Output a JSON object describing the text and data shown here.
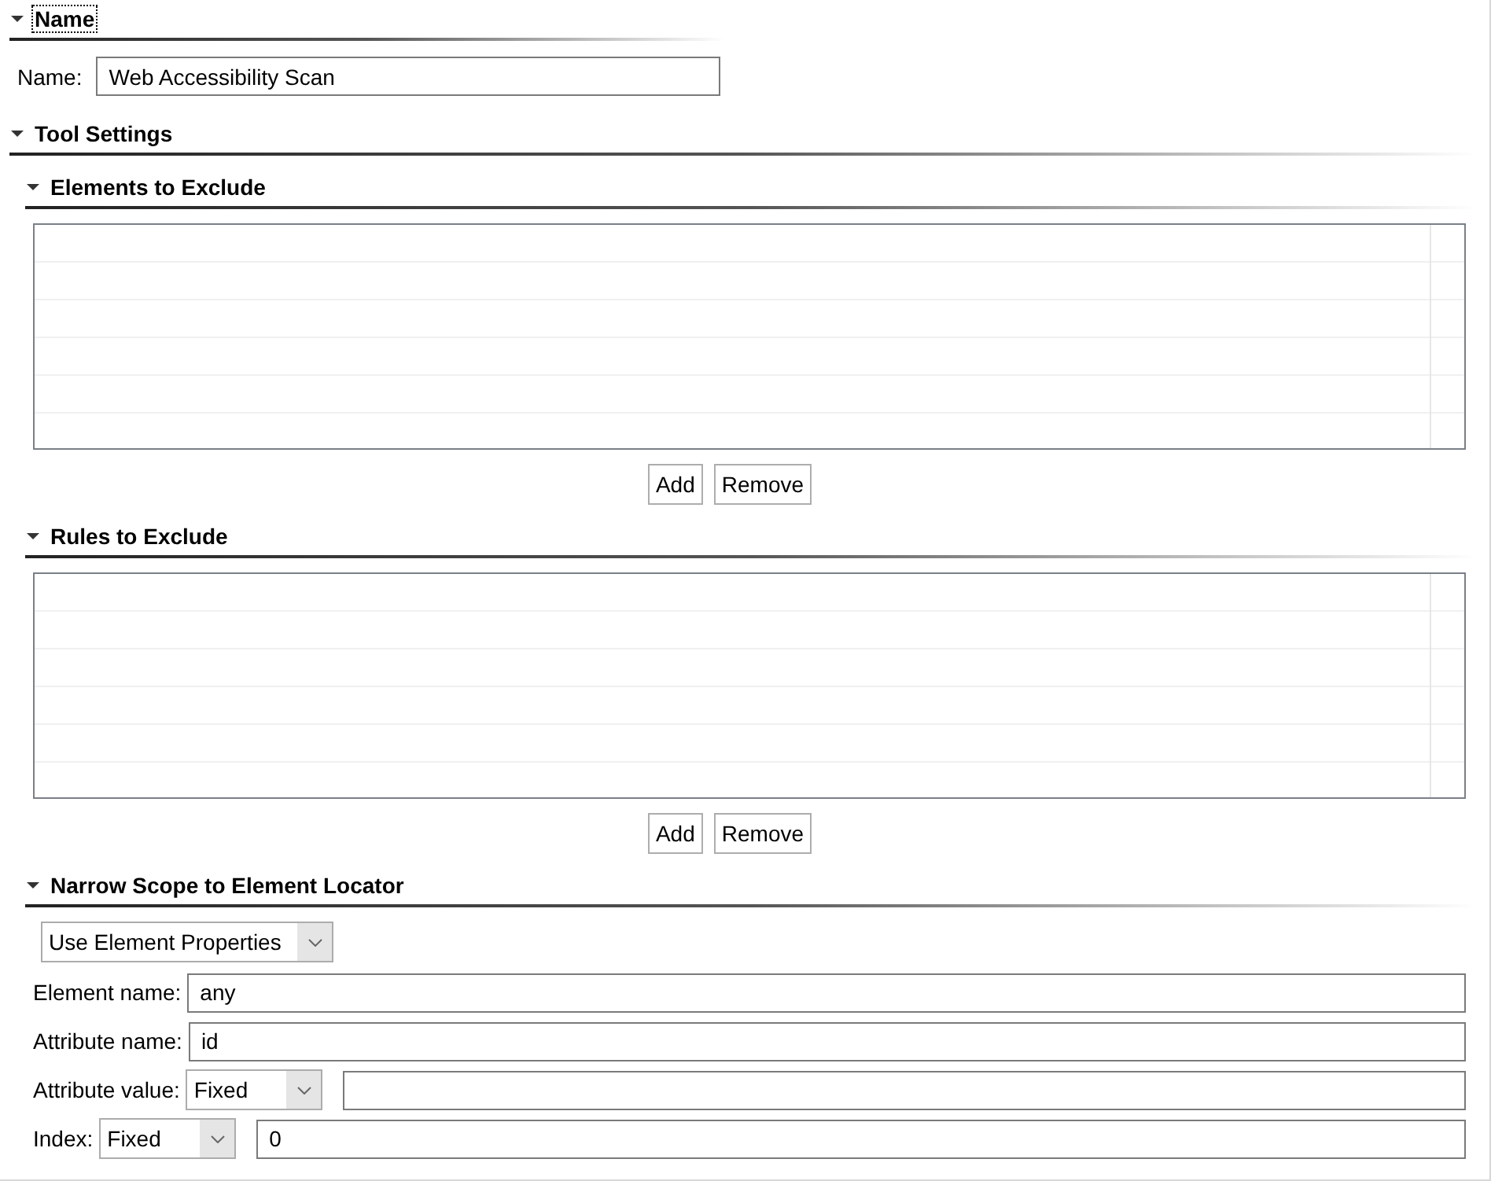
{
  "name_section": {
    "title": "Name",
    "expanded": true,
    "focused": true,
    "label": "Name:",
    "value": "Web Accessibility Scan"
  },
  "tool_settings": {
    "title": "Tool Settings",
    "expanded": true,
    "lists": [
      {
        "title": "Elements to Exclude",
        "expanded": true,
        "buttons": [
          "Add",
          "Remove"
        ]
      },
      {
        "title": "Rules to Exclude",
        "expanded": true,
        "buttons": [
          "Add",
          "Remove"
        ]
      }
    ],
    "locator": {
      "title": "Narrow Scope to Element Locator",
      "expanded": true,
      "mode": "Use Element Properties",
      "rows": [
        {
          "kind": "text",
          "label": "Element name:",
          "value": "any"
        },
        {
          "kind": "text",
          "label": "Attribute name:",
          "value": "id"
        },
        {
          "kind": "combo",
          "label": "Attribute value:",
          "choice": "Fixed"
        },
        {
          "kind": "combo",
          "label": "Index:",
          "choice": "Fixed",
          "value": "0"
        }
      ]
    }
  }
}
